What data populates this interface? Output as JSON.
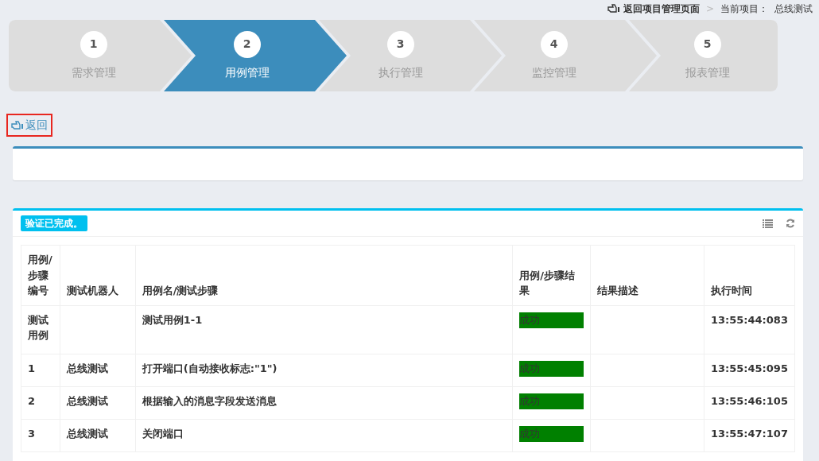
{
  "top_bar": {
    "back_link": "返回项目管理页面",
    "separator": ">",
    "current_label": "当前项目：",
    "current_project": "总线测试"
  },
  "steps": [
    {
      "number": "1",
      "label": "需求管理",
      "selected": false
    },
    {
      "number": "2",
      "label": "用例管理",
      "selected": true
    },
    {
      "number": "3",
      "label": "执行管理",
      "selected": false
    },
    {
      "number": "4",
      "label": "监控管理",
      "selected": false
    },
    {
      "number": "5",
      "label": "报表管理",
      "selected": false
    }
  ],
  "back_button": "返回",
  "results_panel": {
    "status_badge": "验证已完成。",
    "table": {
      "columns": [
        "用例/步骤编号",
        "测试机器人",
        "用例名/测试步骤",
        "用例/步骤结果",
        "结果描述",
        "执行时间"
      ],
      "rows": [
        {
          "number": "测试用例",
          "name": "测试用例1-1",
          "result": "成功",
          "color": "#008000",
          "time": "13:55:44:083"
        },
        {
          "number": "1",
          "robot": "总线测试",
          "name": "打开端口(自动接收标志:\"1\")",
          "result": "成功",
          "color": "#008000",
          "time": "13:55:45:095"
        },
        {
          "number": "2",
          "robot": "总线测试",
          "name": "根据输入的消息字段发送消息",
          "result": "成功",
          "color": "#008000",
          "time": "13:55:46:105"
        },
        {
          "number": "3",
          "robot": "总线测试",
          "name": "关闭端口",
          "result": "成功",
          "color": "#008000",
          "time": "13:55:47:107"
        }
      ]
    }
  }
}
